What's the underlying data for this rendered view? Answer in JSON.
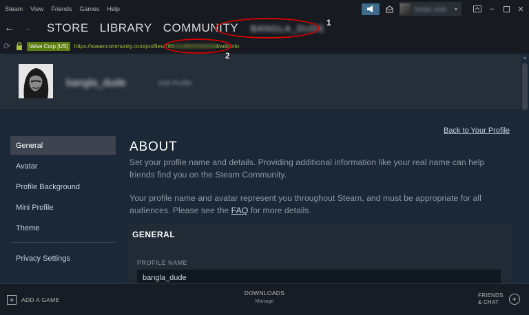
{
  "menubar": {
    "items": [
      "Steam",
      "View",
      "Friends",
      "Games",
      "Help"
    ],
    "account_name": "bangla_dude",
    "window_controls": [
      "minimize",
      "maximize",
      "close"
    ]
  },
  "nav": {
    "store": "STORE",
    "library": "LIBRARY",
    "community": "COMMUNITY",
    "username": "BANGLA_DUDE"
  },
  "urlbar": {
    "cert": "Valve Corp [US]",
    "url_start": "https://steamcommunity.com/profiles/765",
    "url_hidden": "61198000000000",
    "url_end": "4/edit/info"
  },
  "profile": {
    "name": "bangla_dude",
    "subtitle": "Edit Profile"
  },
  "sidebar": {
    "items": [
      "General",
      "Avatar",
      "Profile Background",
      "Mini Profile",
      "Theme"
    ],
    "privacy": "Privacy Settings"
  },
  "main": {
    "back_link": "Back to Your Profile",
    "title": "ABOUT",
    "para1": "Set your profile name and details. Providing additional information like your real name can help friends find you on the Steam Community.",
    "para2_before": "Your profile name and avatar represent you throughout Steam, and must be appropriate for all audiences. Please see the ",
    "para2_link": "FAQ",
    "para2_after": " for more details.",
    "section_title": "GENERAL",
    "field_label": "PROFILE NAME",
    "field_value": "bangla_dude"
  },
  "annotations": {
    "marker1": "1",
    "marker2": "2",
    "color": "#d00000"
  },
  "bottombar": {
    "add_game": "ADD A GAME",
    "downloads": "DOWNLOADS",
    "downloads_sub": "Manage",
    "friends_line1": "FRIENDS",
    "friends_line2": "& CHAT"
  },
  "colors": {
    "background": "#1b2838",
    "chrome": "#171a21",
    "accent_blue": "#3d6c8d",
    "url_green": "#a5c33a",
    "cert_green": "#5c7e10"
  }
}
